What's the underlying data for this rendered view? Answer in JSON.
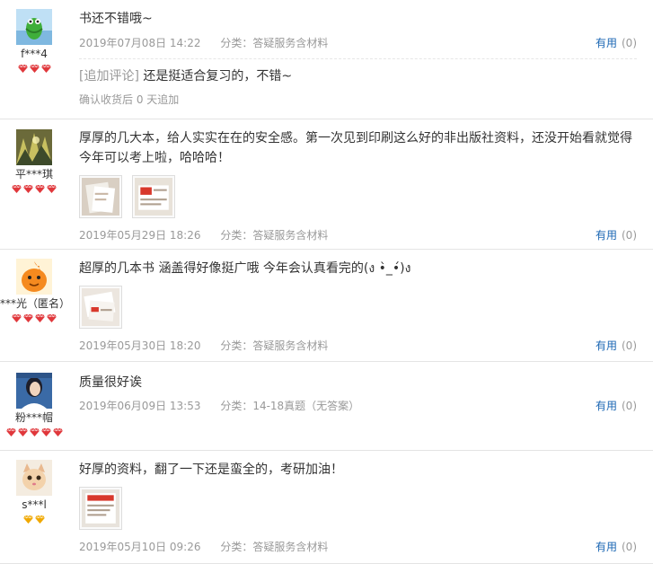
{
  "helpful_label": "有用",
  "reviews": [
    {
      "username": "f***4",
      "gem_color": "#e0373b",
      "gems": 3,
      "text": "书还不错哦~",
      "date": "2019年07月08日 14:22",
      "category": "分类：答疑服务含材料",
      "helpful_count": "(0)",
      "followup_tag": "[追加评论]",
      "followup_text": "还是挺适合复习的，不错~",
      "followup_meta": "确认收货后 0 天追加"
    },
    {
      "username": "平***琪",
      "gem_color": "#e0373b",
      "gems": 4,
      "text": "厚厚的几大本，给人实实在在的安全感。第一次见到印刷这么好的非出版社资料，还没开始看就觉得今年可以考上啦，哈哈哈！",
      "date": "2019年05月29日 18:26",
      "category": "分类：答疑服务含材料",
      "helpful_count": "(0)"
    },
    {
      "username": "***光（匿名）",
      "gem_color": "#e0373b",
      "gems": 4,
      "text": "超厚的几本书 涵盖得好像挺广哦 今年会认真看完的(ง •̀_•́)ง",
      "date": "2019年05月30日 18:20",
      "category": "分类：答疑服务含材料",
      "helpful_count": "(0)"
    },
    {
      "username": "粉***帽",
      "gem_color": "#e0373b",
      "gems": 5,
      "text": "质量很好诶",
      "date": "2019年06月09日 13:53",
      "category": "分类：14-18真题（无答案）",
      "helpful_count": "(0)"
    },
    {
      "username": "s***l",
      "gem_color": "#f0a800",
      "gems": 2,
      "text": "好厚的资料，翻了一下还是蛮全的，考研加油！",
      "date": "2019年05月10日 09:26",
      "category": "分类：答疑服务含材料",
      "helpful_count": "(0)"
    }
  ]
}
